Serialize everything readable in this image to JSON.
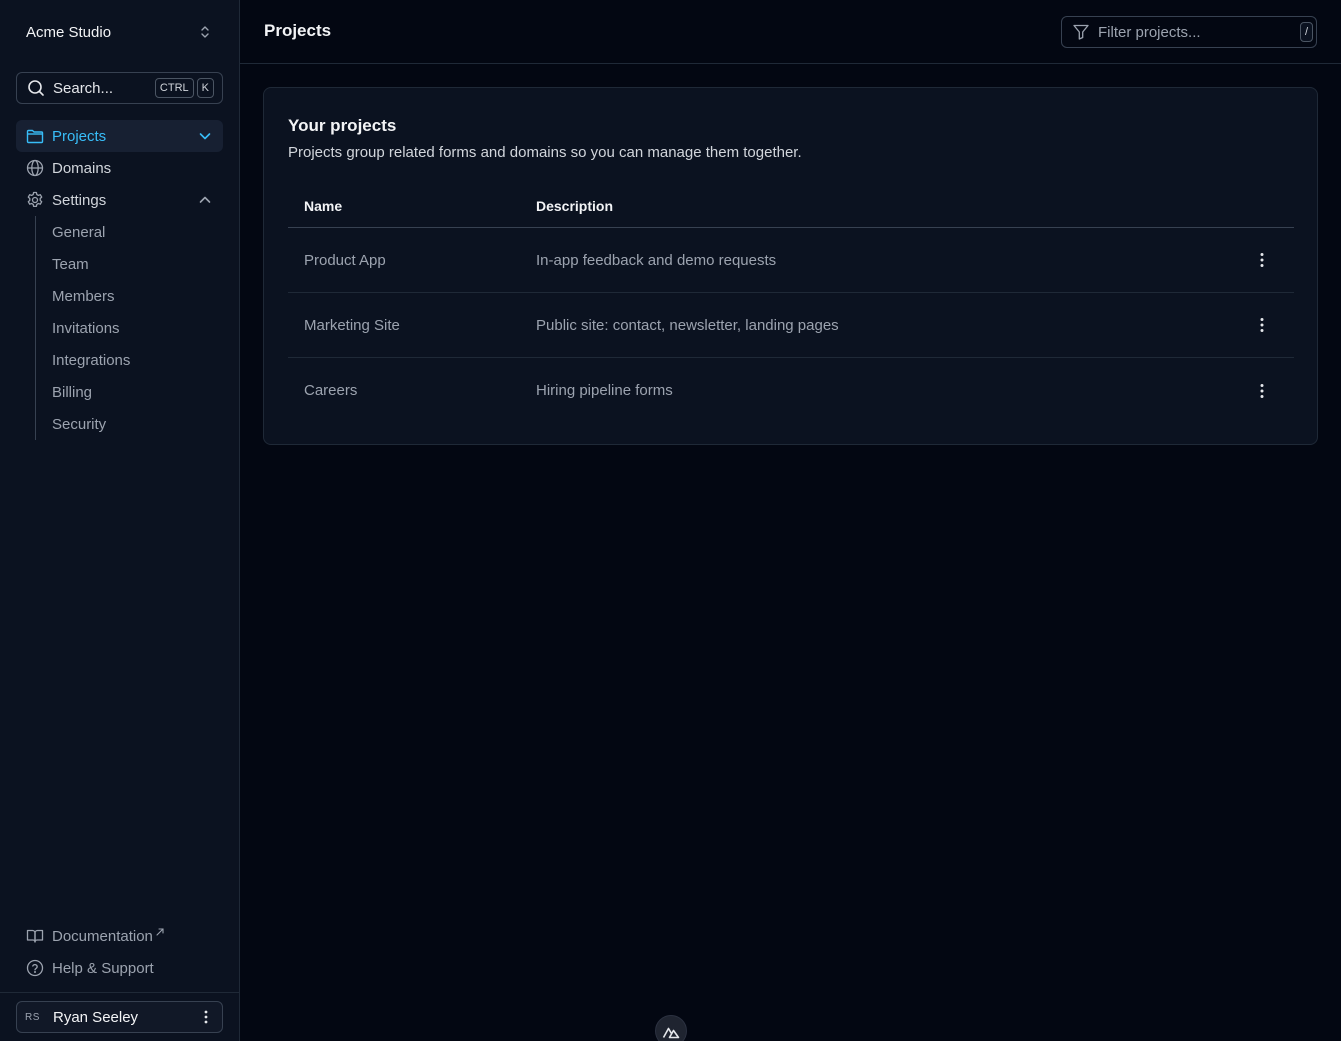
{
  "sidebar": {
    "team_name": "Acme Studio",
    "search": {
      "label": "Search...",
      "shortcut": [
        "CTRL",
        "K"
      ]
    },
    "nav": {
      "projects": "Projects",
      "domains": "Domains",
      "settings": "Settings"
    },
    "settings_items": [
      "General",
      "Team",
      "Members",
      "Invitations",
      "Integrations",
      "Billing",
      "Security"
    ],
    "documentation": "Documentation",
    "help": "Help & Support",
    "user": {
      "initials": "RS",
      "name": "Ryan Seeley"
    }
  },
  "header": {
    "title": "Projects",
    "filter_placeholder": "Filter projects...",
    "filter_shortcut": "/"
  },
  "card": {
    "title": "Your projects",
    "description": "Projects group related forms and domains so you can manage them together.",
    "columns": [
      "Name",
      "Description"
    ],
    "rows": [
      {
        "name": "Product App",
        "description": "In-app feedback and demo requests"
      },
      {
        "name": "Marketing Site",
        "description": "Public site: contact, newsletter, landing pages"
      },
      {
        "name": "Careers",
        "description": "Hiring pipeline forms"
      }
    ]
  },
  "colors": {
    "accent": "#38bdf8",
    "background": "#030712",
    "sidebar": "#0b1220",
    "border": "#1f2937"
  },
  "icons": {
    "team_switch": "chevron-up-down-icon",
    "search": "search-icon",
    "projects": "folder-icon",
    "domains": "globe-icon",
    "settings": "gear-icon",
    "documentation": "book-icon",
    "help": "question-circle-icon",
    "filter": "filter-icon",
    "row_menu": "vertical-dots-icon"
  }
}
